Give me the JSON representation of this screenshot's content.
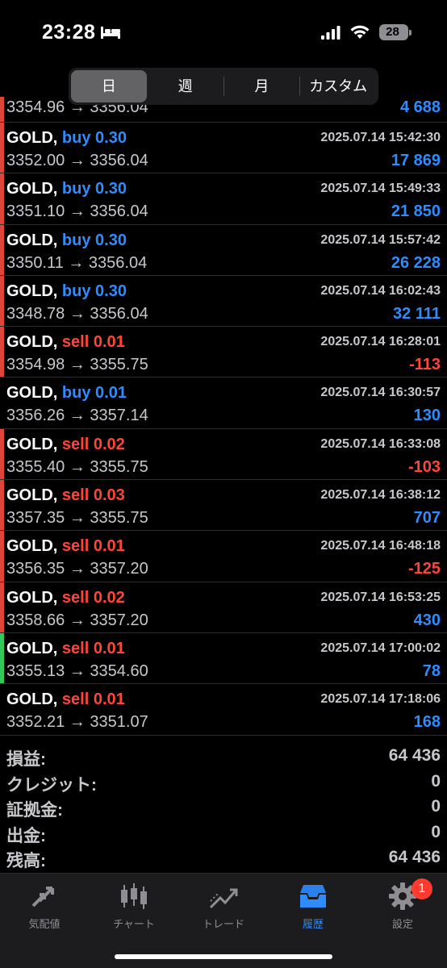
{
  "status_bar": {
    "time": "23:28",
    "battery": "28"
  },
  "segmented": {
    "tabs": [
      "日",
      "週",
      "月",
      "カスタム"
    ],
    "active_index": 0
  },
  "partial_row": {
    "prices": "3354.96 → 3356.04",
    "profit": "4 688"
  },
  "trades": [
    {
      "symbol": "GOLD,",
      "side": "buy 0.30",
      "side_type": "buy",
      "time": "2025.07.14 15:42:30",
      "prices": "3352.00 → 3356.04",
      "profit": "17 869",
      "profit_sign": "pos",
      "marker": "red"
    },
    {
      "symbol": "GOLD,",
      "side": "buy 0.30",
      "side_type": "buy",
      "time": "2025.07.14 15:49:33",
      "prices": "3351.10 → 3356.04",
      "profit": "21 850",
      "profit_sign": "pos",
      "marker": "red"
    },
    {
      "symbol": "GOLD,",
      "side": "buy 0.30",
      "side_type": "buy",
      "time": "2025.07.14 15:57:42",
      "prices": "3350.11 → 3356.04",
      "profit": "26 228",
      "profit_sign": "pos",
      "marker": "red"
    },
    {
      "symbol": "GOLD,",
      "side": "buy 0.30",
      "side_type": "buy",
      "time": "2025.07.14 16:02:43",
      "prices": "3348.78 → 3356.04",
      "profit": "32 111",
      "profit_sign": "pos",
      "marker": "red"
    },
    {
      "symbol": "GOLD,",
      "side": "sell 0.01",
      "side_type": "sell",
      "time": "2025.07.14 16:28:01",
      "prices": "3354.98 → 3355.75",
      "profit": "-113",
      "profit_sign": "neg",
      "marker": "red"
    },
    {
      "symbol": "GOLD,",
      "side": "buy 0.01",
      "side_type": "buy",
      "time": "2025.07.14 16:30:57",
      "prices": "3356.26 → 3357.14",
      "profit": "130",
      "profit_sign": "pos",
      "marker": "none"
    },
    {
      "symbol": "GOLD,",
      "side": "sell 0.02",
      "side_type": "sell",
      "time": "2025.07.14 16:33:08",
      "prices": "3355.40 → 3355.75",
      "profit": "-103",
      "profit_sign": "neg",
      "marker": "red"
    },
    {
      "symbol": "GOLD,",
      "side": "sell 0.03",
      "side_type": "sell",
      "time": "2025.07.14 16:38:12",
      "prices": "3357.35 → 3355.75",
      "profit": "707",
      "profit_sign": "pos",
      "marker": "red"
    },
    {
      "symbol": "GOLD,",
      "side": "sell 0.01",
      "side_type": "sell",
      "time": "2025.07.14 16:48:18",
      "prices": "3356.35 → 3357.20",
      "profit": "-125",
      "profit_sign": "neg",
      "marker": "red"
    },
    {
      "symbol": "GOLD,",
      "side": "sell 0.02",
      "side_type": "sell",
      "time": "2025.07.14 16:53:25",
      "prices": "3358.66 → 3357.20",
      "profit": "430",
      "profit_sign": "pos",
      "marker": "red"
    },
    {
      "symbol": "GOLD,",
      "side": "sell 0.01",
      "side_type": "sell",
      "time": "2025.07.14 17:00:02",
      "prices": "3355.13 → 3354.60",
      "profit": "78",
      "profit_sign": "pos",
      "marker": "green"
    },
    {
      "symbol": "GOLD,",
      "side": "sell 0.01",
      "side_type": "sell",
      "time": "2025.07.14 17:18:06",
      "prices": "3352.21 → 3351.07",
      "profit": "168",
      "profit_sign": "pos",
      "marker": "none"
    }
  ],
  "summary": [
    {
      "label": "損益:",
      "value": "64 436"
    },
    {
      "label": "クレジット:",
      "value": "0"
    },
    {
      "label": "証拠金:",
      "value": "0"
    },
    {
      "label": "出金:",
      "value": "0"
    },
    {
      "label": "残高:",
      "value": "64 436"
    }
  ],
  "tabbar": {
    "items": [
      {
        "label": "気配値",
        "icon": "quotes-arrows-icon"
      },
      {
        "label": "チャート",
        "icon": "candlestick-icon"
      },
      {
        "label": "トレード",
        "icon": "trade-chart-icon"
      },
      {
        "label": "履歴",
        "icon": "history-tray-icon"
      },
      {
        "label": "設定",
        "icon": "gear-icon"
      }
    ],
    "active_index": 3,
    "settings_badge": "1"
  },
  "colors": {
    "buy": "#2f8cff",
    "sell": "#ff453a",
    "marker_red": "#e0453a",
    "marker_green": "#34c759"
  }
}
